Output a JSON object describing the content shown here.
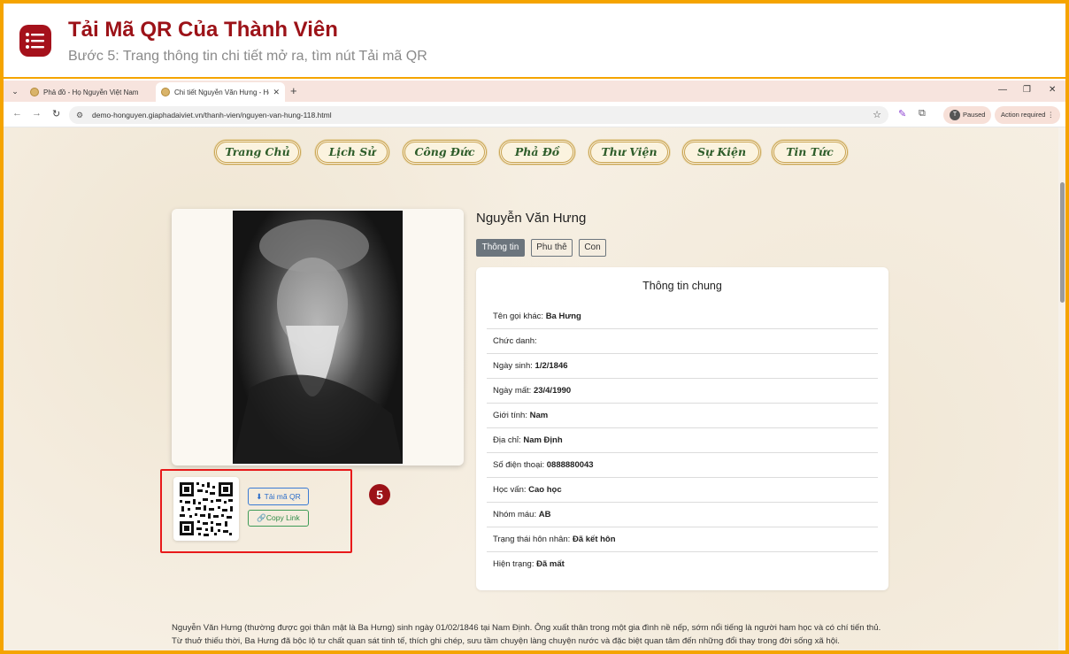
{
  "tutorial": {
    "title": "Tải Mã QR Của Thành Viên",
    "subtitle": "Bước 5: Trang thông tin chi tiết mở ra, tìm nút Tải mã QR",
    "step_number": "5"
  },
  "browser": {
    "tabs": [
      {
        "title": "Phả đồ - Họ Nguyễn Việt Nam"
      },
      {
        "title": "Chi tiết Nguyễn Văn Hưng - Họ"
      }
    ],
    "url": "demo-honguyen.giaphadaiviet.vn/thanh-vien/nguyen-van-hung-118.html",
    "profile_status": "Paused",
    "profile_initial": "T",
    "action_label": "Action required"
  },
  "nav": {
    "items": [
      "Trang Chủ",
      "Lịch Sử",
      "Công Đức",
      "Phả Đồ",
      "Thư Viện",
      "Sự Kiện",
      "Tin Tức"
    ]
  },
  "qr": {
    "download_label": "Tải mã QR",
    "copy_label": "Copy Link"
  },
  "person": {
    "name": "Nguyễn Văn Hưng",
    "tabs": [
      "Thông tin",
      "Phu thê",
      "Con"
    ],
    "section_title": "Thông tin chung",
    "fields": [
      {
        "label": "Tên gọi khác:",
        "value": "Ba Hưng"
      },
      {
        "label": "Chức danh:",
        "value": ""
      },
      {
        "label": "Ngày sinh:",
        "value": "1/2/1846"
      },
      {
        "label": "Ngày mất:",
        "value": "23/4/1990"
      },
      {
        "label": "Giới tính:",
        "value": "Nam"
      },
      {
        "label": "Địa chỉ:",
        "value": "Nam Định"
      },
      {
        "label": "Số điện thoại:",
        "value": "0888880043"
      },
      {
        "label": "Học vấn:",
        "value": "Cao học"
      },
      {
        "label": "Nhóm máu:",
        "value": "AB"
      },
      {
        "label": "Trạng thái hôn nhân:",
        "value": "Đã kết hôn"
      },
      {
        "label": "Hiện trạng:",
        "value": "Đã mất"
      }
    ],
    "bio": "Nguyễn Văn Hưng (thường được gọi thân mật là Ba Hưng) sinh ngày 01/02/1846 tại Nam Định. Ông xuất thân trong một gia đình nề nếp, sớm nổi tiếng là người ham học và có chí tiến thủ. Từ thuở thiếu thời, Ba Hưng đã bộc lộ tư chất quan sát tinh tế, thích ghi chép, sưu tầm chuyện làng chuyện nước và đặc biệt quan tâm đến những đổi thay trong đời sống xã hội."
  },
  "colors": {
    "frame": "#f5a400",
    "brand": "#9c1218",
    "highlight": "#e8191a",
    "nav_text": "#2e5d2a"
  }
}
